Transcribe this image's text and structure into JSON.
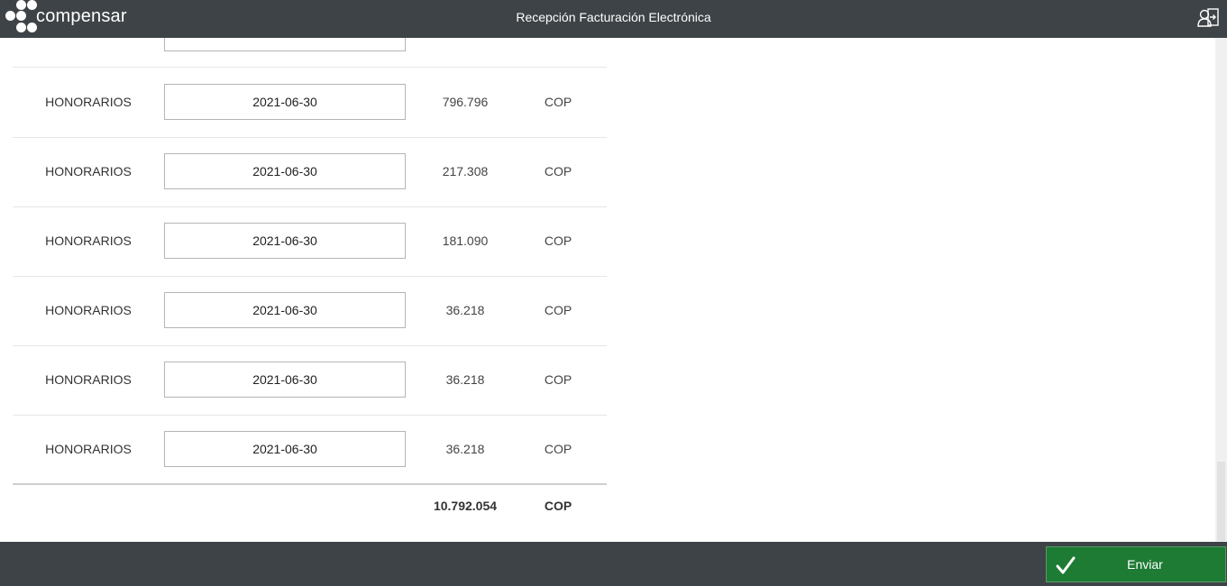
{
  "header": {
    "brand": "compensar",
    "title": "Recepción Facturación Electrónica",
    "user_icon": "user-exit-icon"
  },
  "rows": [
    {
      "concept": "",
      "date": "",
      "amount": "",
      "currency": ""
    },
    {
      "concept": "HONORARIOS",
      "date": "2021-06-30",
      "amount": "796.796",
      "currency": "COP"
    },
    {
      "concept": "HONORARIOS",
      "date": "2021-06-30",
      "amount": "217.308",
      "currency": "COP"
    },
    {
      "concept": "HONORARIOS",
      "date": "2021-06-30",
      "amount": "181.090",
      "currency": "COP"
    },
    {
      "concept": "HONORARIOS",
      "date": "2021-06-30",
      "amount": "36.218",
      "currency": "COP"
    },
    {
      "concept": "HONORARIOS",
      "date": "2021-06-30",
      "amount": "36.218",
      "currency": "COP"
    },
    {
      "concept": "HONORARIOS",
      "date": "2021-06-30",
      "amount": "36.218",
      "currency": "COP"
    }
  ],
  "total": {
    "amount": "10.792.054",
    "currency": "COP"
  },
  "footer": {
    "send_label": "Enviar",
    "send_icon": "check-icon"
  },
  "colors": {
    "bar": "#3d4346",
    "send": "#1e7b34"
  }
}
